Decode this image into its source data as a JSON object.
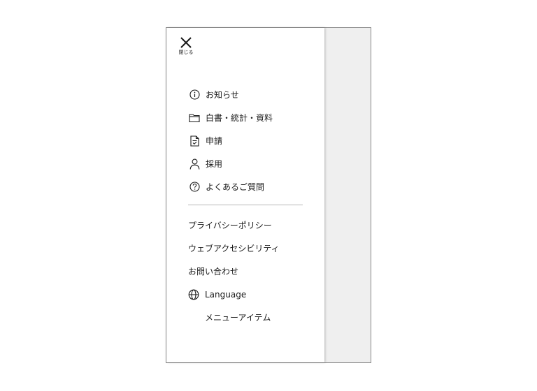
{
  "drawer": {
    "close_label": "閉じる"
  },
  "menu": {
    "items": [
      {
        "label": "お知らせ",
        "icon": "info-icon"
      },
      {
        "label": "白書・統計・資料",
        "icon": "folder-icon"
      },
      {
        "label": "申請",
        "icon": "document-icon"
      },
      {
        "label": "採用",
        "icon": "person-icon"
      },
      {
        "label": "よくあるご質問",
        "icon": "question-icon"
      }
    ]
  },
  "sub_menu": {
    "items": [
      {
        "label": "プライバシーポリシー"
      },
      {
        "label": "ウェブアクセシビリティ"
      },
      {
        "label": "お問い合わせ"
      },
      {
        "label": "Language",
        "icon": "globe-icon"
      },
      {
        "label": "メニューアイテム"
      }
    ]
  }
}
